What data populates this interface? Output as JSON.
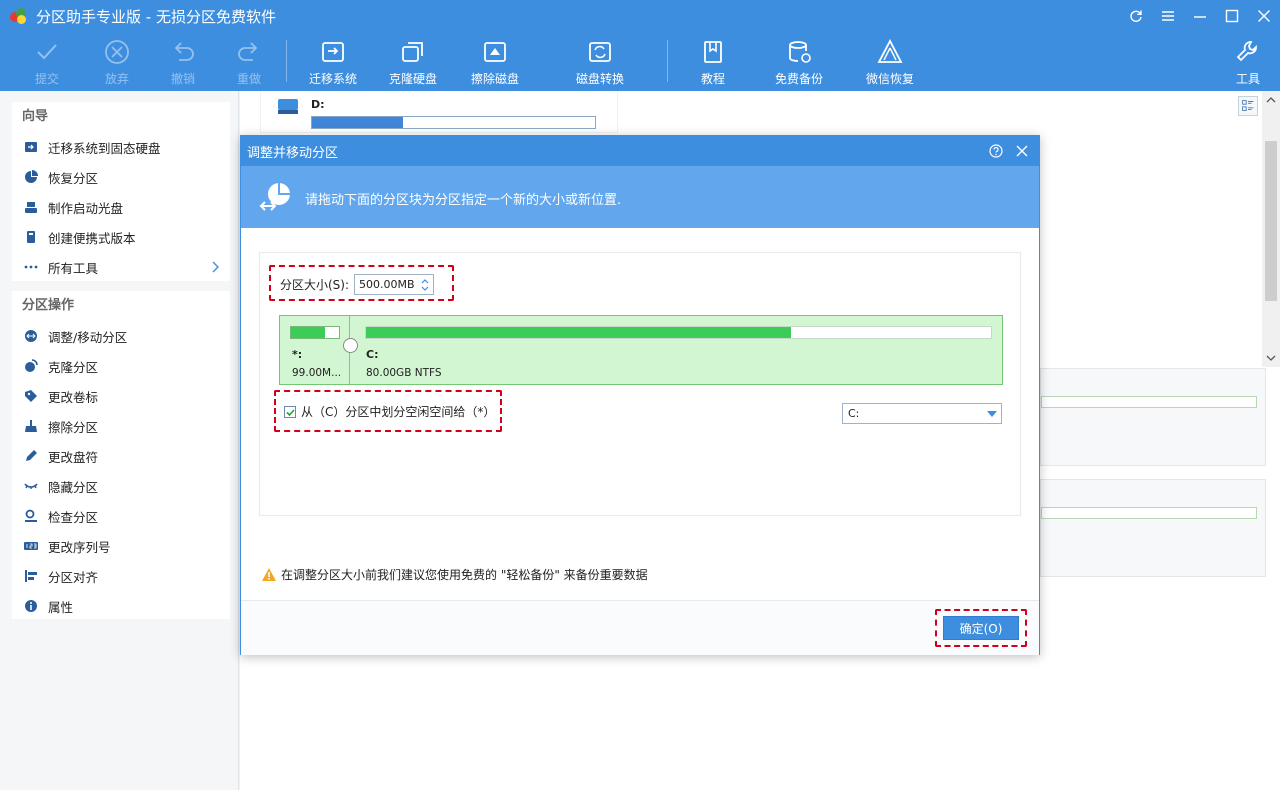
{
  "window": {
    "title": "分区助手专业版 - 无损分区免费软件"
  },
  "toolbar": {
    "submit": "提交",
    "discard": "放弃",
    "undo": "撤销",
    "redo": "重做",
    "migrate_os": "迁移系统",
    "clone_disk": "克隆硬盘",
    "wipe_disk": "擦除磁盘",
    "disk_convert": "磁盘转换",
    "tutorial": "教程",
    "free_backup": "免费备份",
    "wechat_recovery": "微信恢复",
    "tools": "工具"
  },
  "sidebar": {
    "wizard_title": "向导",
    "wizard_items": [
      "迁移系统到固态硬盘",
      "恢复分区",
      "制作启动光盘",
      "创建便携式版本",
      "所有工具"
    ],
    "ops_title": "分区操作",
    "ops_items": [
      "调整/移动分区",
      "克隆分区",
      "更改卷标",
      "擦除分区",
      "更改盘符",
      "隐藏分区",
      "检查分区",
      "更改序列号",
      "分区对齐",
      "属性"
    ]
  },
  "background": {
    "disk_label": "D:",
    "disk_used_fraction": 0.32
  },
  "dialog": {
    "title": "调整并移动分区",
    "banner_text": "请拖动下面的分区块为分区指定一个新的大小或新位置.",
    "size_label": "分区大小(S):",
    "size_value": "500.00MB",
    "small_part_label": "*:",
    "small_part_size": "99.00M...",
    "small_part_used_fraction": 0.7,
    "big_part_label": "C:",
    "big_part_size": "80.00GB NTFS",
    "big_part_used_fraction": 0.68,
    "checkbox_label": "从（C）分区中划分空闲空间给（*）",
    "checkbox_checked": true,
    "select_value": "C:",
    "warning_text": "在调整分区大小前我们建议您使用免费的 \"轻松备份\" 来备份重要数据",
    "ok_label": "确定(O)"
  },
  "colors": {
    "accent": "#3e8ee0",
    "banner": "#62a7ee",
    "partition_green": "#3ccd58",
    "highlight_red": "#d0021b"
  }
}
